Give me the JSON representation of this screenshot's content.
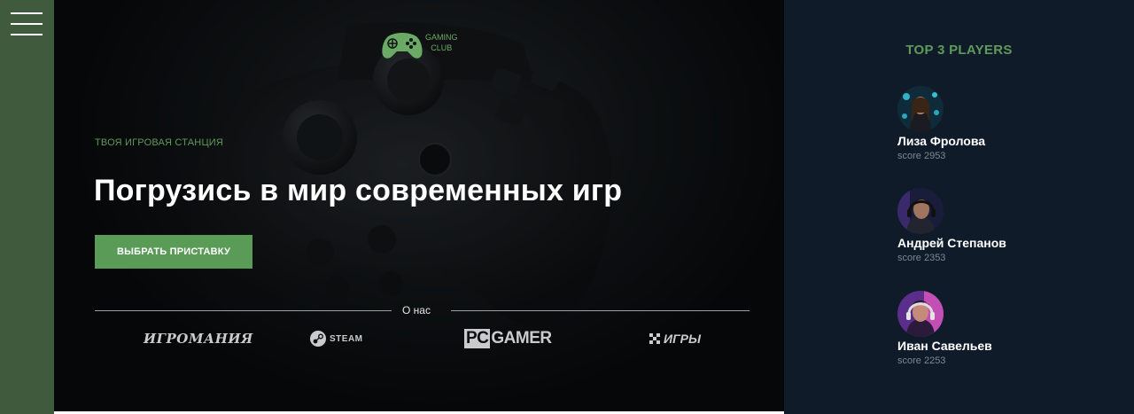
{
  "sidebar": {
    "menu_icon": "hamburger-menu-icon"
  },
  "logo": {
    "line1": "GAMING",
    "line2": "CLUB",
    "icon": "gamepad-icon",
    "color": "#6aaa64"
  },
  "hero": {
    "subtitle": "ТВОЯ ИГРОВАЯ СТАНЦИЯ",
    "headline": "Погрузись в мир современных игр",
    "cta_label": "ВЫБРАТЬ ПРИСТАВКУ",
    "about_label": "О нас"
  },
  "partners": {
    "igromania": "ИГРОМАНИЯ",
    "steam": "STEAM",
    "pcgamer_pc": "PC",
    "pcgamer_rest": "GAMER",
    "igry": "ИГРЫ"
  },
  "top_players": {
    "title": "TOP 3 PLAYERS",
    "players": [
      {
        "name": "Лиза Фролова",
        "score": "score 2953"
      },
      {
        "name": "Андрей Степанов",
        "score": "score 2353"
      },
      {
        "name": "Иван Савельев",
        "score": "score 2253"
      }
    ]
  },
  "colors": {
    "accent": "#5a9b57",
    "sidebar": "#3f5a3d",
    "panel": "#101b2a"
  }
}
